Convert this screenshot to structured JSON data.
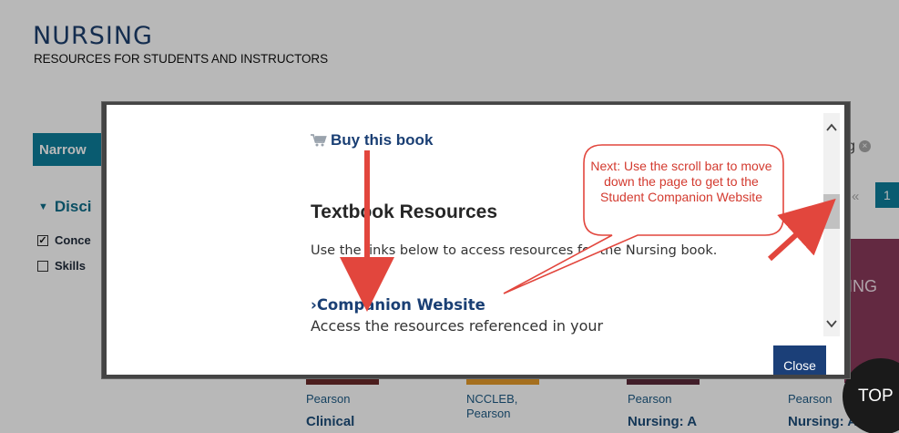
{
  "site": {
    "brand_title": "NURSING",
    "brand_subtitle": "RESOURCES FOR STUDENTS AND INSTRUCTORS"
  },
  "sidebar": {
    "narrow_tab_label": "Narrow",
    "discipline_heading": "Disci",
    "filters": [
      {
        "label": "Conce",
        "checked": true
      },
      {
        "label": "Skills",
        "checked": false
      }
    ]
  },
  "results": {
    "active_filter_label": "g",
    "prev_label": "«",
    "current_page": "1",
    "books": [
      {
        "publisher": "Pearson",
        "title": "Clinical"
      },
      {
        "publisher": "NCCLEB,\nPearson",
        "title": ""
      },
      {
        "publisher": "Pearson",
        "title": "Nursing: A"
      },
      {
        "publisher": "Pearson",
        "title": "Nursing: A"
      }
    ],
    "cover_text": "ING",
    "top_button_label": "TOP"
  },
  "modal": {
    "buy_label": "Buy this book",
    "section_heading": "Textbook Resources",
    "description": "Use the links below to access resources for the Nursing book.",
    "link_prefix": "›",
    "link_label": "Companion Website",
    "link_description": "Access the resources referenced in your",
    "close_label": "Close",
    "scroll_position_fraction": 0.39
  },
  "annotation": {
    "callout_text": "Next: Use the scroll bar to move down the page to get to the Student Companion Website",
    "color": "#d33a2f"
  },
  "colors": {
    "brand": "#1d3f6e",
    "accent": "#0d7e9b",
    "link": "#1a3f74",
    "close_button": "#1b3f78"
  }
}
